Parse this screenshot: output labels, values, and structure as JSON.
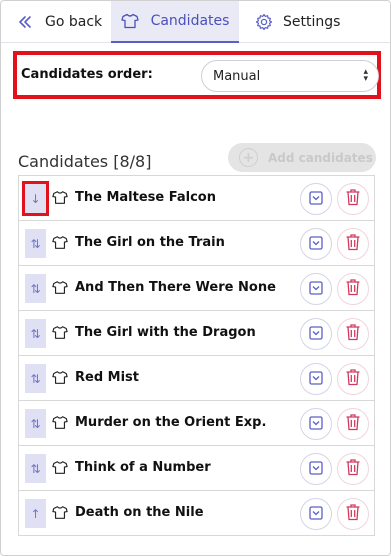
{
  "nav": {
    "back_label": "Go back",
    "candidates_label": "Candidates",
    "settings_label": "Settings"
  },
  "order": {
    "label": "Candidates order:",
    "selected": "Manual"
  },
  "candidates": {
    "title": "Candidates [8/8]",
    "add_label": "Add candidates",
    "items": [
      {
        "label": "The Maltese Falcon",
        "handle": "down-arrow-icon"
      },
      {
        "label": "The Girl on the Train",
        "handle": "up-down-arrows-icon"
      },
      {
        "label": "And Then There Were None",
        "handle": "up-down-arrows-icon"
      },
      {
        "label": "The Girl with the Dragon",
        "handle": "up-down-arrows-icon"
      },
      {
        "label": "Red Mist",
        "handle": "up-down-arrows-icon"
      },
      {
        "label": "Murder on the Orient Exp.",
        "handle": "up-down-arrows-icon"
      },
      {
        "label": "Think of a Number",
        "handle": "up-down-arrows-icon"
      },
      {
        "label": "Death on the Nile",
        "handle": "up-arrow-icon"
      }
    ]
  },
  "colors": {
    "accent": "#5a5fc8",
    "highlight": "#e1121b",
    "delete": "#d2385e"
  }
}
